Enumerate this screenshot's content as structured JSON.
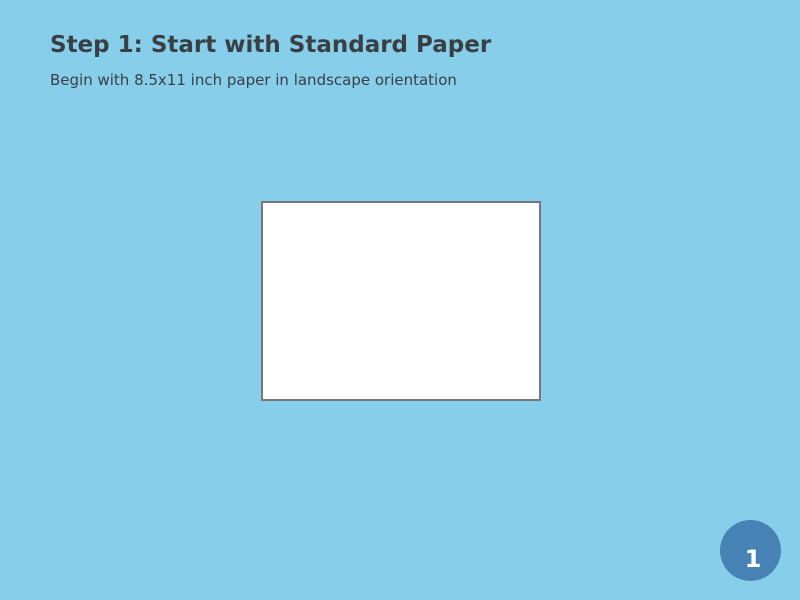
{
  "colors": {
    "background": "#87ceeb",
    "text": "#3a3f44",
    "paper_fill": "#ffffff",
    "paper_border": "#777777",
    "badge": "#4682b4",
    "badge_text": "#ffffff"
  },
  "header": {
    "title": "Step 1: Start with Standard Paper",
    "subtitle": "Begin with 8.5x11 inch paper in landscape orientation"
  },
  "badge": {
    "number": "1"
  }
}
